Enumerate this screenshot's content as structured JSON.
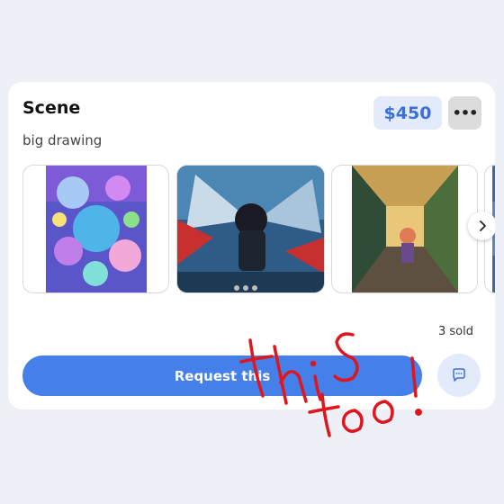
{
  "listing": {
    "title": "Scene",
    "subtitle": "big drawing",
    "price": "$450",
    "sold": "3 sold",
    "request_label": "Request this"
  },
  "annotation": {
    "line1": "this",
    "line2": "too!",
    "color": "#e0161e"
  },
  "colors": {
    "accent": "#4580ea",
    "price_bg": "#e3ebfb",
    "price_text": "#3a6fe0"
  },
  "gallery": [
    {
      "name": "thumbnail-purple-fantasy-art"
    },
    {
      "name": "thumbnail-winged-character-art"
    },
    {
      "name": "thumbnail-green-corridor-art"
    },
    {
      "name": "thumbnail-partial-art"
    }
  ],
  "icons": [
    "more-dots-icon",
    "chevron-right-icon",
    "chat-icon"
  ]
}
